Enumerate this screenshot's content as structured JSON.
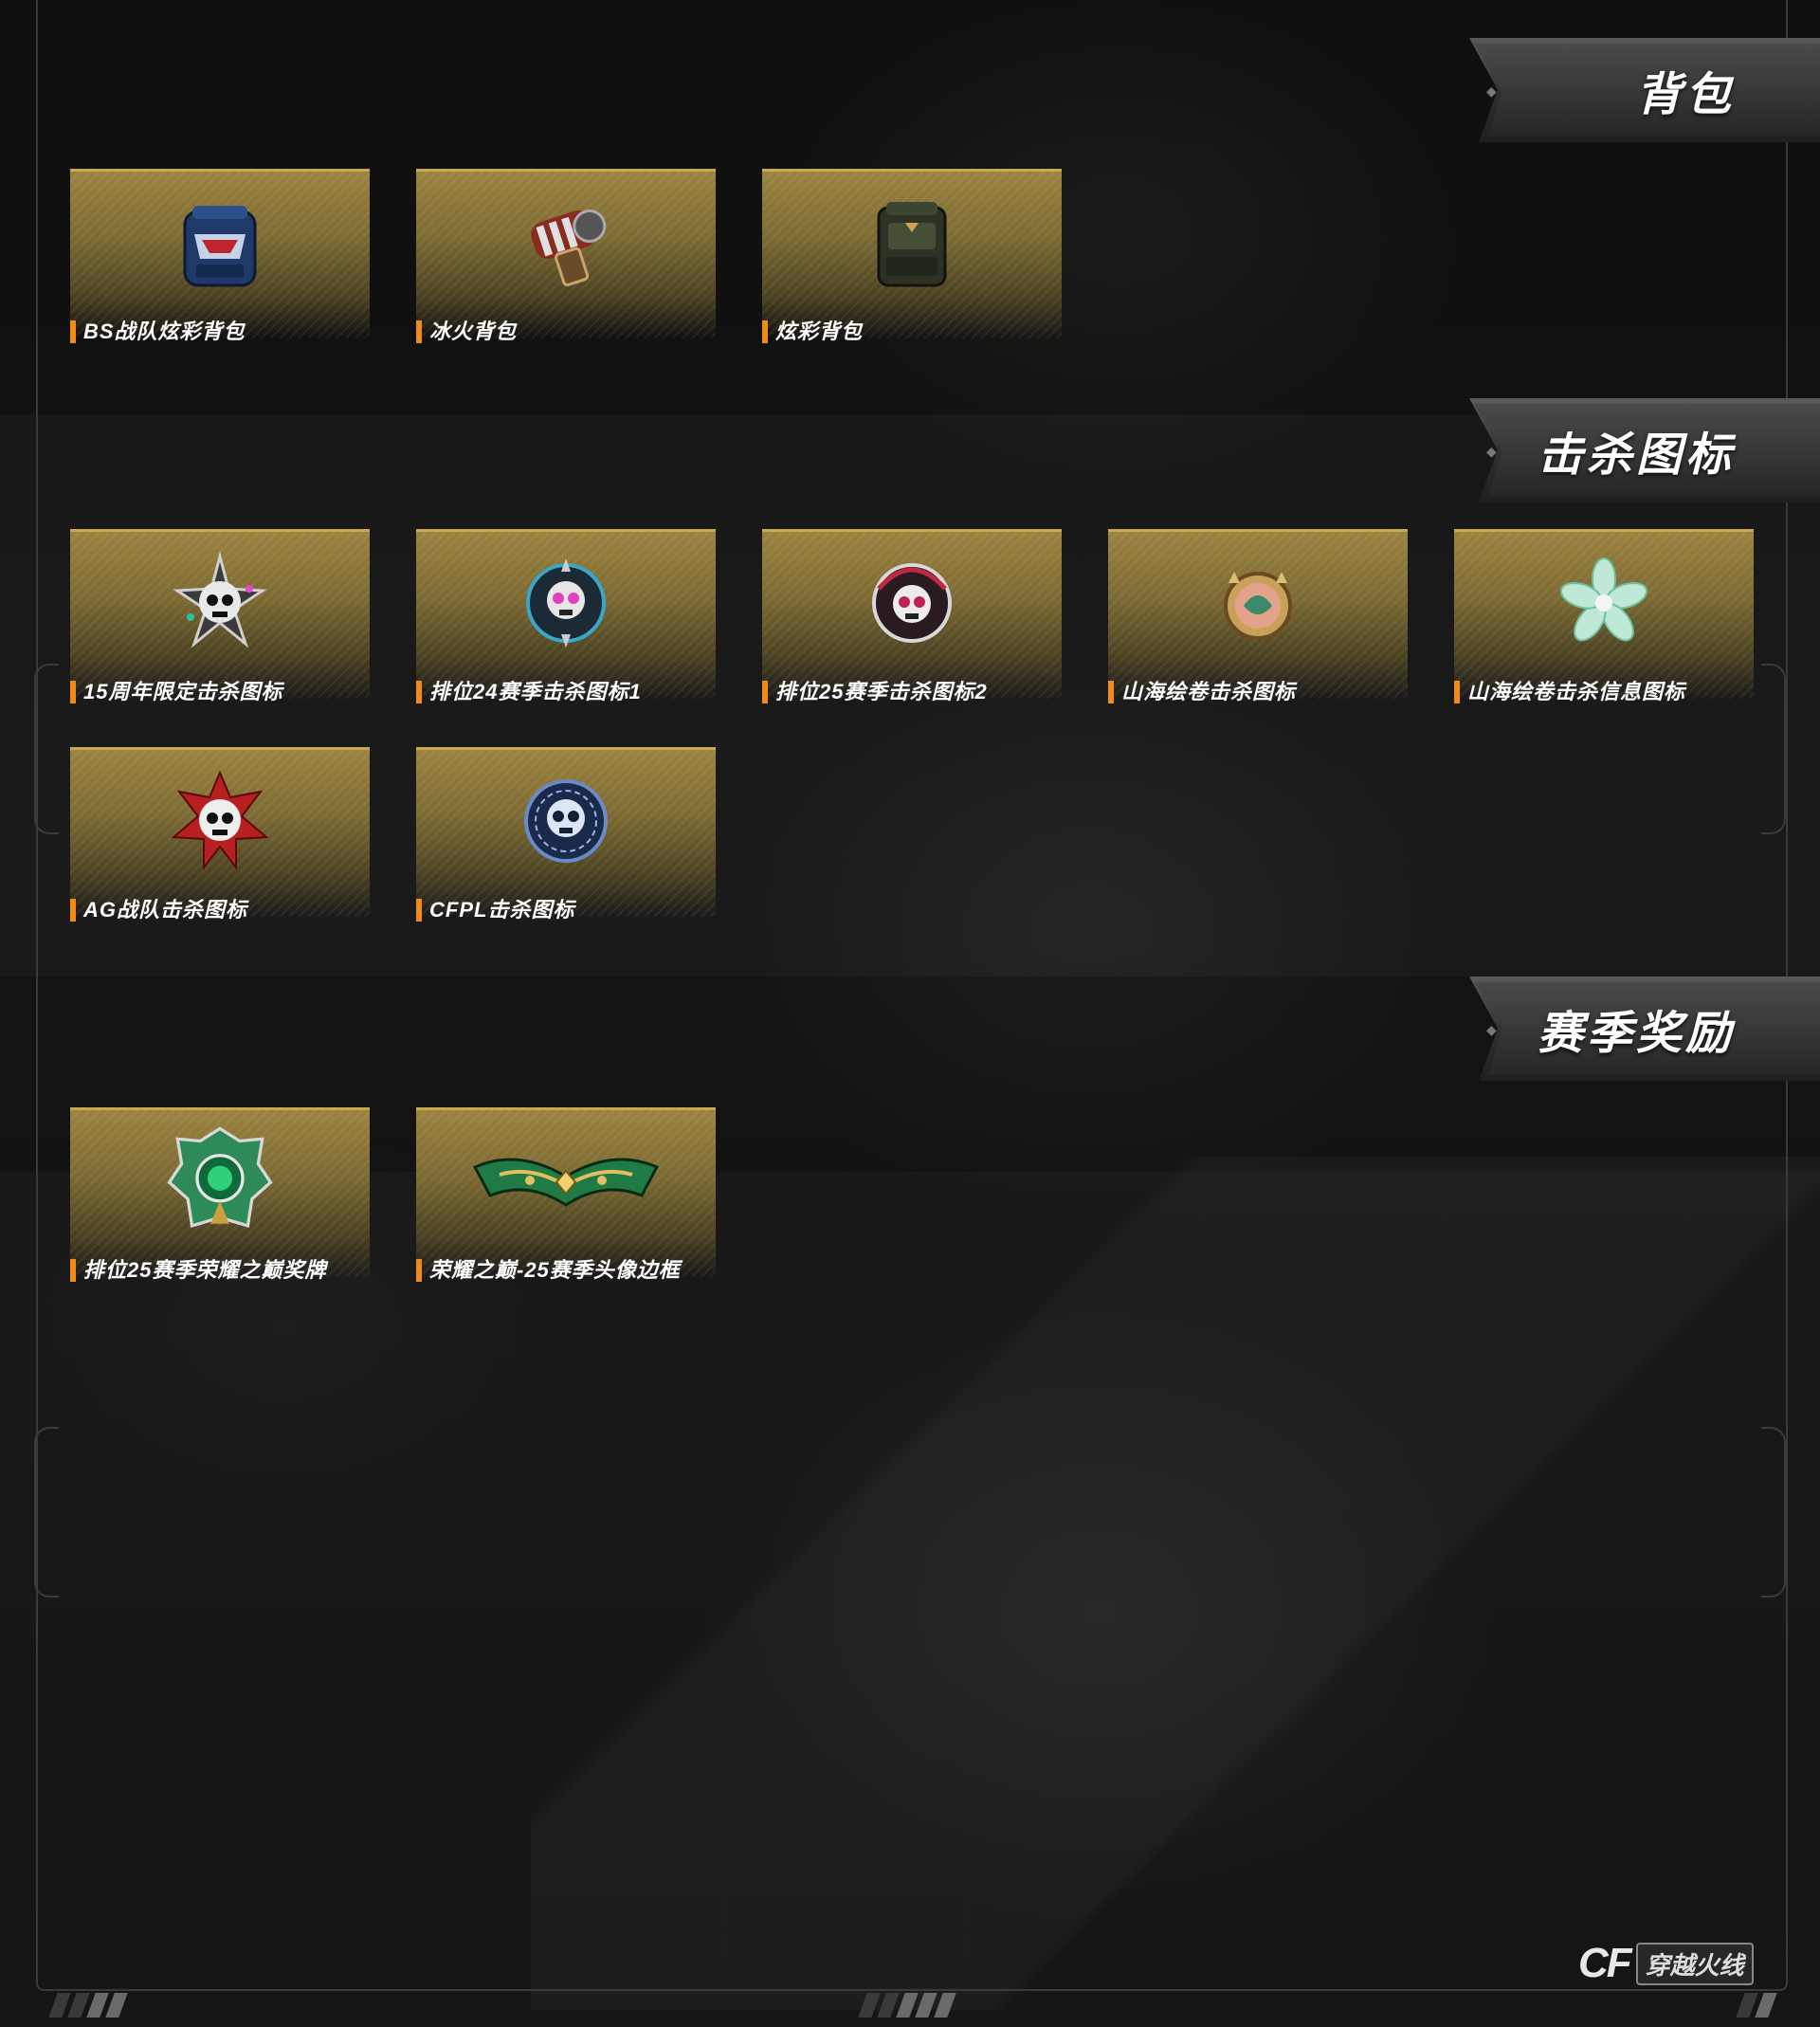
{
  "sections": [
    {
      "title": "背包",
      "items": [
        {
          "label": "BS战队炫彩背包",
          "icon": "backpack-bs-icon"
        },
        {
          "label": "冰火背包",
          "icon": "backpack-icefire-icon"
        },
        {
          "label": "炫彩背包",
          "icon": "backpack-color-icon"
        }
      ]
    },
    {
      "title": "击杀图标",
      "items": [
        {
          "label": "15周年限定击杀图标",
          "icon": "skull-15th-icon"
        },
        {
          "label": "排位24赛季击杀图标1",
          "icon": "skull-rank24-icon"
        },
        {
          "label": "排位25赛季击杀图标2",
          "icon": "skull-rank25-icon"
        },
        {
          "label": "山海绘卷击杀图标",
          "icon": "shanhai-kill-icon"
        },
        {
          "label": "山海绘卷击杀信息图标",
          "icon": "shanhai-flower-icon"
        },
        {
          "label": "AG战队击杀图标",
          "icon": "skull-ag-icon"
        },
        {
          "label": "CFPL击杀图标",
          "icon": "skull-cfpl-icon"
        }
      ]
    },
    {
      "title": "赛季奖励",
      "items": [
        {
          "label": "排位25赛季荣耀之巅奖牌",
          "icon": "medal-glory-icon"
        },
        {
          "label": "荣耀之巅-25赛季头像边框",
          "icon": "avatar-frame-icon"
        }
      ]
    }
  ],
  "logo": {
    "mark": "CF",
    "name": "穿越火线"
  }
}
